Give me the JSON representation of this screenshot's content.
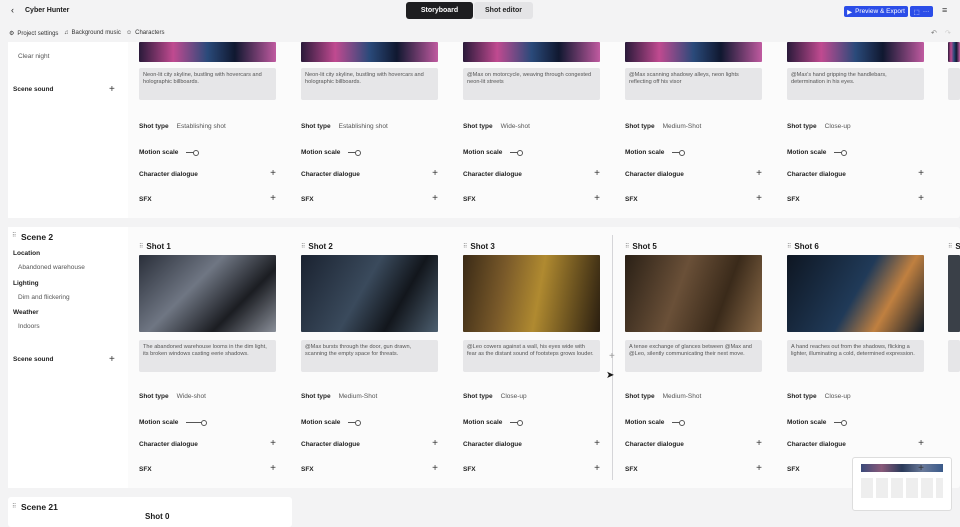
{
  "header": {
    "back_icon": "chevron-left-icon",
    "title": "Cyber Hunter",
    "tabs": [
      "Storyboard",
      "Shot editor"
    ],
    "preview_label": "Preview & Export",
    "share_more": "···",
    "menu_icon": "hamburger-icon"
  },
  "toolbar": {
    "items": [
      "Project settings",
      "Background music",
      "Characters"
    ]
  },
  "labels": {
    "shot_type": "Shot type",
    "motion_scale": "Motion scale",
    "character_dialogue": "Character dialogue",
    "sfx": "SFX",
    "location": "Location",
    "lighting": "Lighting",
    "weather": "Weather",
    "scene_sound": "Scene sound"
  },
  "scene1": {
    "weather_value": "Clear night",
    "shots": [
      {
        "desc": "Neon-lit city skyline, bustling with hovercars and holographic billboards.",
        "shot_type": "Establishing shot"
      },
      {
        "desc": "Neon-lit city skyline, bustling with hovercars and holographic billboards.",
        "shot_type": "Establishing shot"
      },
      {
        "desc": "@Max on motorcycle, weaving through congested neon-lit streets",
        "shot_type": "Wide-shot"
      },
      {
        "desc": "@Max scanning shadowy alleys, neon lights reflecting off his visor",
        "shot_type": "Medium-Shot"
      },
      {
        "desc": "@Max's hand gripping the handlebars, determination in his eyes.",
        "shot_type": "Close-up"
      }
    ]
  },
  "scene2": {
    "title": "Scene 2",
    "location": "Abandoned warehouse",
    "lighting": "Dim and flickering",
    "weather": "Indoors",
    "shots": [
      {
        "title": "Shot 1",
        "desc": "The abandoned warehouse looms in the dim light, its broken windows casting eerie shadows.",
        "shot_type": "Wide-shot"
      },
      {
        "title": "Shot 2",
        "desc": "@Max bursts through the door, gun drawn, scanning the empty space for threats.",
        "shot_type": "Medium-Shot"
      },
      {
        "title": "Shot 3",
        "desc": "@Leo cowers against a wall, his eyes wide with fear as the distant sound of footsteps grows louder.",
        "shot_type": "Close-up"
      },
      {
        "title": "Shot 5",
        "desc": "A tense exchange of glances between @Max and @Leo, silently communicating their next move.",
        "shot_type": "Medium-Shot"
      },
      {
        "title": "Shot 6",
        "desc": "A hand reaches out from the shadows, flicking a lighter, illuminating a cold, determined expression.",
        "shot_type": "Close-up"
      },
      {
        "title": "Sh"
      }
    ]
  },
  "scene3": {
    "title": "Scene 21",
    "first_shot": "Shot 0"
  },
  "colors": {
    "accent": "#2b4de8",
    "dark_tab": "#1e1e20"
  }
}
